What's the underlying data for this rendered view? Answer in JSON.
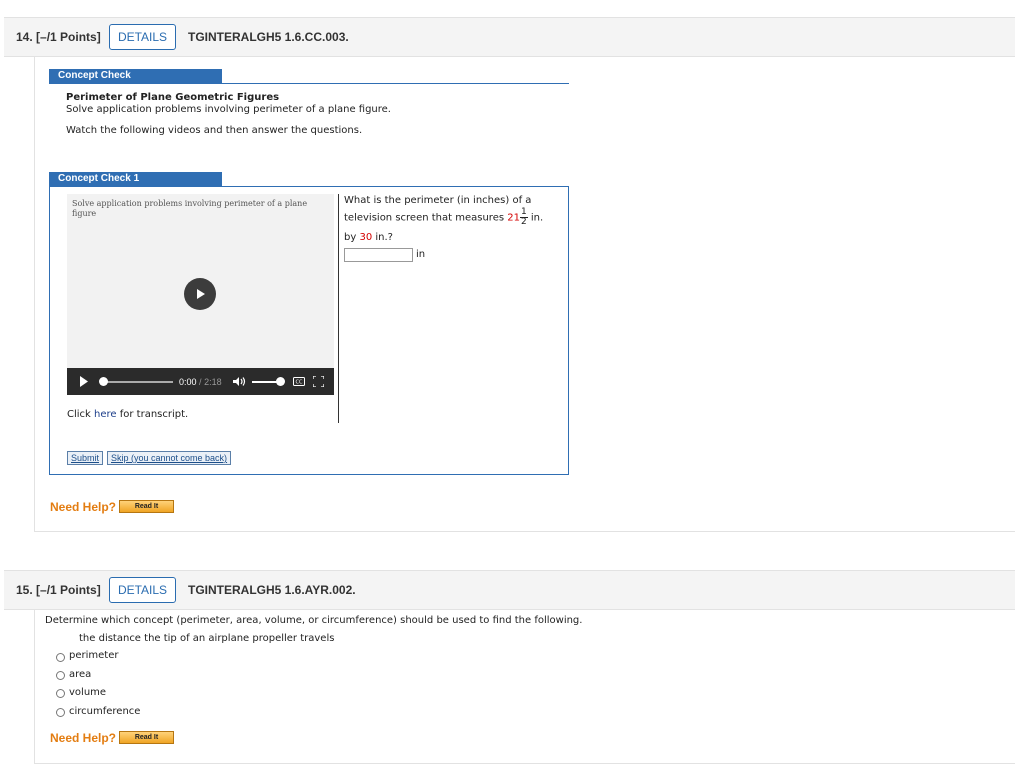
{
  "q14": {
    "number": "14.",
    "points": "[–/1 Points]",
    "details_label": "DETAILS",
    "code": "TGINTERALGH5 1.6.CC.003.",
    "concept_check_header": "Concept Check",
    "topic_title": "Perimeter of Plane Geometric Figures",
    "topic_desc": "Solve application problems involving perimeter of a plane figure.",
    "instructions": "Watch the following videos and then answer the questions.",
    "cc1_header": "Concept Check 1",
    "video_caption_line1": "Solve application problems involving perimeter of a plane",
    "video_caption_line2": "figure",
    "time_current": "0:00",
    "time_sep": "/",
    "time_total": "2:18",
    "transcript_pre": "Click ",
    "transcript_link": "here",
    "transcript_post": " for transcript.",
    "question_line1": "What is the perimeter (in inches) of a",
    "question_line2_pre": "television screen that measures ",
    "whole": "21",
    "frac_num": "1",
    "frac_den": "2",
    "question_line2_post": " in.",
    "question_line3_pre": "by ",
    "value2": "30",
    "question_line3_post": " in.?",
    "answer_value": "",
    "unit": "in",
    "submit_label": "Submit",
    "skip_label": "Skip (you cannot come back)",
    "need_help": "Need Help?",
    "read_it": "Read It"
  },
  "q15": {
    "number": "15.",
    "points": "[–/1 Points]",
    "details_label": "DETAILS",
    "code": "TGINTERALGH5 1.6.AYR.002.",
    "prompt": "Determine which concept (perimeter, area, volume, or circumference) should be used to find the following.",
    "item": "the distance the tip of an airplane propeller travels",
    "options": [
      "perimeter",
      "area",
      "volume",
      "circumference"
    ],
    "need_help": "Need Help?",
    "read_it": "Read It"
  },
  "colors": {
    "accent_blue": "#2f6eb3",
    "help_orange": "#e37d12",
    "highlight_red": "#d40000"
  }
}
